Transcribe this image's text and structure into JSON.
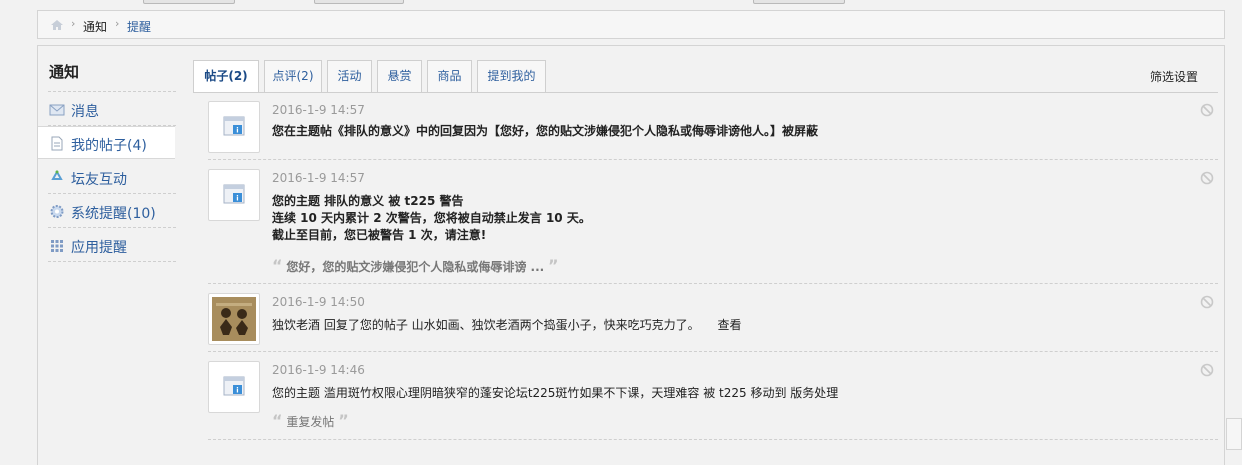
{
  "breadcrumb": {
    "home_icon": "home-icon",
    "items": [
      "通知",
      "提醒"
    ]
  },
  "sidebar": {
    "title": "通知",
    "items": [
      {
        "label": "消息",
        "icon": "envelope-icon"
      },
      {
        "label": "我的帖子(4)",
        "icon": "document-icon"
      },
      {
        "label": "坛友互动",
        "icon": "recycle-icon"
      },
      {
        "label": "系统提醒(10)",
        "icon": "gear-icon"
      },
      {
        "label": "应用提醒",
        "icon": "grid-icon"
      }
    ]
  },
  "tabs": [
    "帖子(2)",
    "点评(2)",
    "活动",
    "悬赏",
    "商品",
    "提到我的"
  ],
  "filter_label": "筛选设置",
  "notifications": [
    {
      "time": "2016-1-9 14:57",
      "lines": [
        "您在主题帖《排队的意义》中的回复因为【您好，您的贴文涉嫌侵犯个人隐私或侮辱诽谤他人。】被屏蔽"
      ]
    },
    {
      "time": "2016-1-9 14:57",
      "lines": [
        "您的主题 排队的意义 被 t225 警告",
        "连续 10 天内累计 2 次警告，您将被自动禁止发言 10 天。",
        "截止至目前，您已被警告 1 次，请注意!"
      ],
      "quote": "您好，您的贴文涉嫌侵犯个人隐私或侮辱诽谤 ..."
    },
    {
      "time": "2016-1-9 14:50",
      "text": "独饮老酒 回复了您的帖子 山水如画、独饮老酒两个捣蛋小子，快来吃巧克力了。",
      "link": "查看"
    },
    {
      "time": "2016-1-9 14:46",
      "text": "您的主题 滥用斑竹权限心理阴暗狭窄的蓬安论坛t225斑竹如果不下课，天理难容 被 t225 移动到 版务处理",
      "quote": "重复发帖"
    }
  ],
  "colors": {
    "link": "#2e5f9e",
    "bg": "#f2f2f2",
    "time": "#9a9a9a"
  }
}
